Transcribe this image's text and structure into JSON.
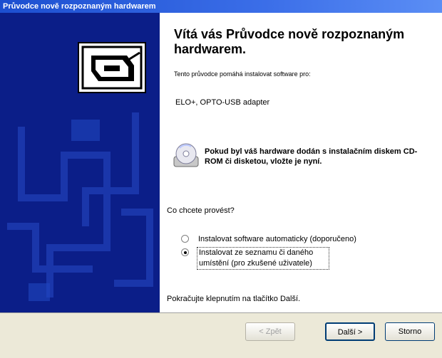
{
  "window": {
    "title": "Průvodce nově rozpoznaným hardwarem"
  },
  "main": {
    "heading": "Vítá vás Průvodce nově rozpoznaným hardwarem.",
    "subtitle": "Tento průvodce pomáhá instalovat software pro:",
    "device_name": "ELO+, OPTO-USB adapter",
    "cd_note": "Pokud byl váš hardware dodán s instalačním diskem CD-ROM či disketou, vložte je nyní.",
    "question": "Co chcete provést?",
    "options": [
      {
        "label": "Instalovat software automaticky (doporučeno)",
        "selected": false
      },
      {
        "label": "Instalovat ze seznamu či daného umístění (pro zkušené uživatele)",
        "selected": true
      }
    ],
    "hint": "Pokračujte klepnutím na tlačítko Další."
  },
  "buttons": {
    "back": "< Zpět",
    "next": "Další >",
    "cancel": "Storno"
  },
  "icons": {
    "side": "hardware-device-icon",
    "cd": "cd-rom-icon"
  },
  "colors": {
    "title_bar": "#1c4fd0",
    "side_panel": "#0b1e88",
    "footer": "#ece9d8"
  }
}
